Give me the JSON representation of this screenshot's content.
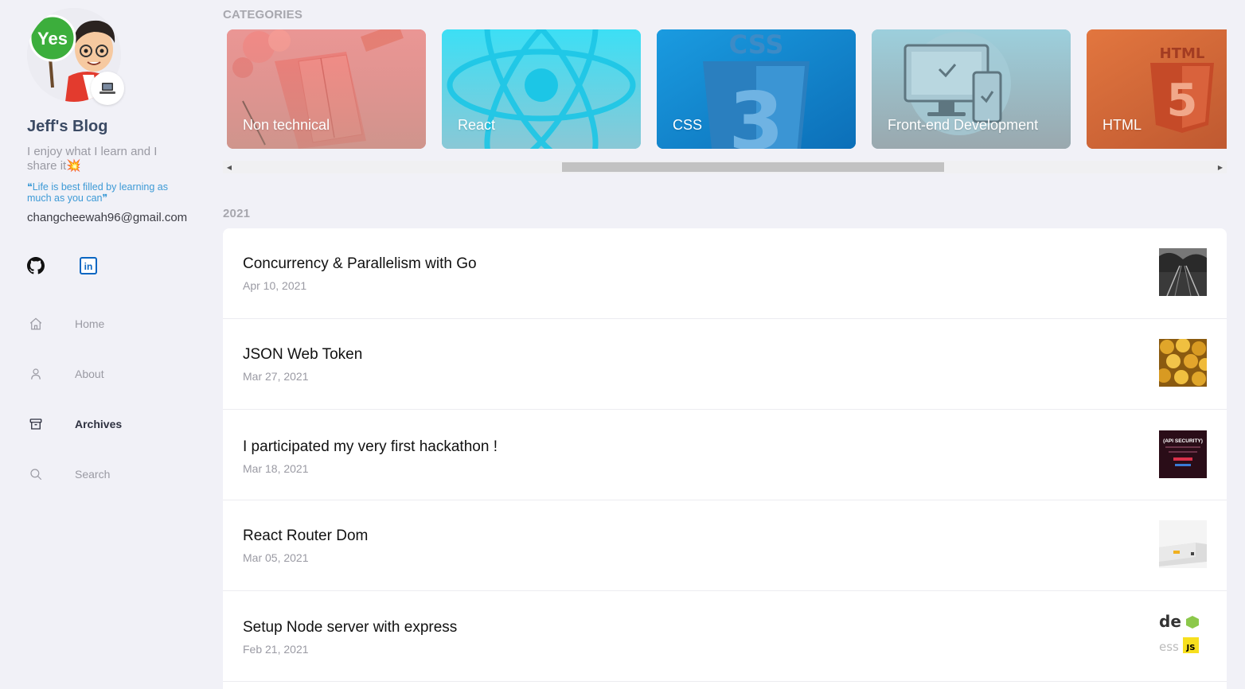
{
  "sidebar": {
    "blog_title": "Jeff's Blog",
    "bio": "I enjoy what I learn and I share it",
    "bio_emoji": "💥",
    "avatar_sign": "Yes",
    "quote": "❝Life is best filled by learning as much as you can❞",
    "email": "changcheewah96@gmail.com",
    "socials": [
      {
        "name": "github",
        "icon": "github-icon"
      },
      {
        "name": "linkedin",
        "icon": "linkedin-icon",
        "text": "in"
      }
    ],
    "nav": [
      {
        "label": "Home",
        "icon": "home-icon",
        "active": false
      },
      {
        "label": "About",
        "icon": "user-icon",
        "active": false
      },
      {
        "label": "Archives",
        "icon": "archive-icon",
        "active": true
      },
      {
        "label": "Search",
        "icon": "search-icon",
        "active": false
      }
    ]
  },
  "categories": {
    "heading": "CATEGORIES",
    "items": [
      {
        "label": "Non technical",
        "color": "#e8908f"
      },
      {
        "label": "React",
        "color": "#5fd6ea"
      },
      {
        "label": "CSS",
        "color": "#1a8dd3"
      },
      {
        "label": "Front-end Development",
        "color": "#9fc6d4"
      },
      {
        "label": "HTML",
        "color": "#d4633a"
      }
    ],
    "css_logo_text": "CSS",
    "html_logo_text": "HTML",
    "html_logo_number": "5",
    "css_logo_number": "3"
  },
  "year_heading": "2021",
  "posts": [
    {
      "title": "Concurrency & Parallelism with Go",
      "date": "Apr 10, 2021"
    },
    {
      "title": "JSON Web Token",
      "date": "Mar 27, 2021"
    },
    {
      "title": "I participated my very first hackathon !",
      "date": "Mar 18, 2021",
      "thumb_text": "(API SECURITY)"
    },
    {
      "title": "React Router Dom",
      "date": "Mar 05, 2021"
    },
    {
      "title": "Setup Node server with express",
      "date": "Feb 21, 2021",
      "thumb_text_1": "de",
      "thumb_text_2": "ess",
      "thumb_text_3": "JS"
    }
  ]
}
